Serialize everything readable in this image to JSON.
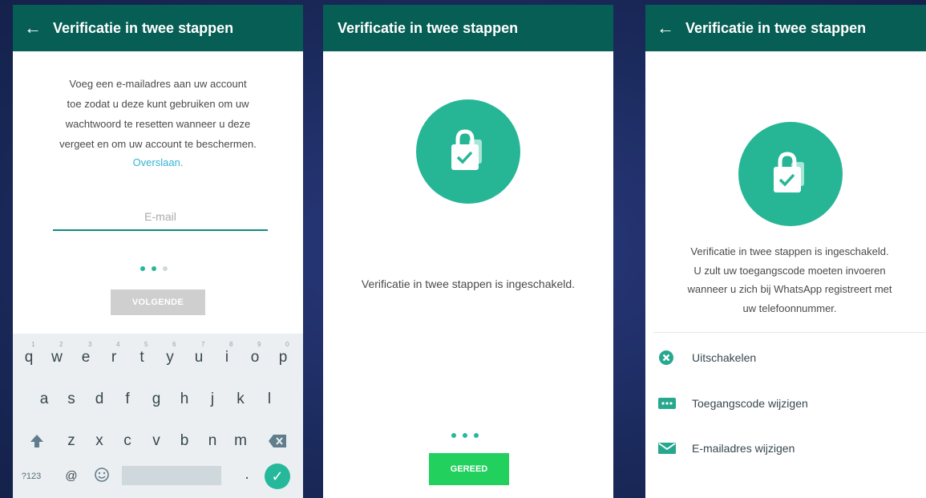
{
  "colors": {
    "appbar": "#075e54",
    "accent": "#25b89a",
    "link": "#35b3d3",
    "done_button": "#22d05e",
    "disabled_button": "#cfcfcf"
  },
  "screen1": {
    "title": "Verificatie in twee stappen",
    "intro_lines": [
      "Voeg een e-mailadres aan uw account",
      "toe zodat u deze kunt gebruiken om uw",
      "wachtwoord te resetten wanneer u deze",
      "vergeet en om uw account te beschermen."
    ],
    "skip_link": "Overslaan.",
    "email_placeholder": "E-mail",
    "next_button": "VOLGENDE",
    "progress_step": 2,
    "progress_total": 3,
    "keyboard": {
      "row1": [
        "q",
        "w",
        "e",
        "r",
        "t",
        "y",
        "u",
        "i",
        "o",
        "p"
      ],
      "row1_numbers": [
        "1",
        "2",
        "3",
        "4",
        "5",
        "6",
        "7",
        "8",
        "9",
        "0"
      ],
      "row2": [
        "a",
        "s",
        "d",
        "f",
        "g",
        "h",
        "j",
        "k",
        "l"
      ],
      "row3": [
        "z",
        "x",
        "c",
        "v",
        "b",
        "n",
        "m"
      ],
      "symbols_key": "?123",
      "at_key": "@",
      "period_key": ".",
      "icons": [
        "shift-icon",
        "backspace-icon",
        "emoji-icon",
        "check-icon"
      ]
    }
  },
  "screen2": {
    "title": "Verificatie in twee stappen",
    "message": "Verificatie in twee stappen is ingeschakeld.",
    "done_button": "GEREED",
    "progress_step": 3,
    "progress_total": 3
  },
  "screen3": {
    "title": "Verificatie in twee stappen",
    "message_lines": [
      "Verificatie in twee stappen is ingeschakeld.",
      "U zult uw toegangscode moeten invoeren",
      "wanneer u zich bij WhatsApp registreert met",
      "uw telefoonnummer."
    ],
    "options": [
      {
        "label": "Uitschakelen",
        "icon": "cancel-icon"
      },
      {
        "label": "Toegangscode wijzigen",
        "icon": "passcode-icon"
      },
      {
        "label": "E-mailadres wijzigen",
        "icon": "mail-icon"
      }
    ]
  }
}
